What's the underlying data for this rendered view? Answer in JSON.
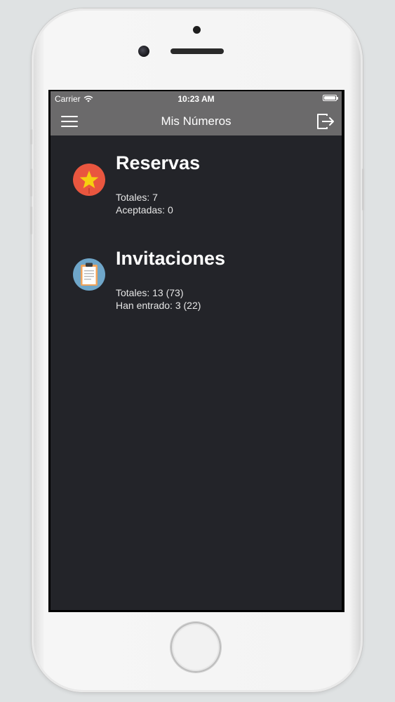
{
  "status_bar": {
    "carrier": "Carrier",
    "time": "10:23 AM"
  },
  "nav": {
    "title": "Mis Números",
    "menu_icon": "hamburger-menu-icon",
    "logout_icon": "logout-icon"
  },
  "sections": [
    {
      "title": "Reservas",
      "icon": "star-icon",
      "icon_bg": "#e9563f",
      "icon_fg": "#f6d00f",
      "stats": [
        "Totales: 7",
        "Aceptadas: 0"
      ]
    },
    {
      "title": "Invitaciones",
      "icon": "clipboard-icon",
      "icon_bg": "#6fa6c9",
      "icon_fg": "#f0a35a",
      "stats": [
        "Totales: 13 (73)",
        "Han entrado: 3 (22)"
      ]
    }
  ],
  "colors": {
    "nav_bg": "#6b6a6b",
    "screen_bg": "#232429",
    "text": "#ffffff"
  }
}
